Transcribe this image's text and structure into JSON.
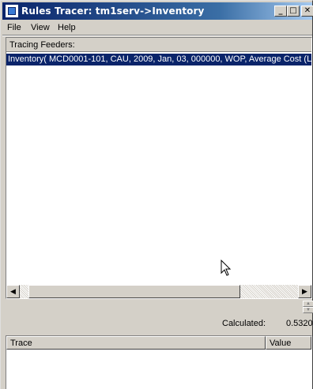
{
  "window": {
    "title": "Rules Tracer: tm1serv->Inventory",
    "controls": {
      "minimize": "_",
      "maximize": "□",
      "close": "✕"
    }
  },
  "menu": {
    "file": "File",
    "view": "View",
    "help": "Help"
  },
  "feeders": {
    "header": "Tracing Feeders:",
    "rows": [
      "Inventory( MCD0001-101, CAU, 2009, Jan, 03, 000000, WOP, Average Cost (L"
    ]
  },
  "calculated": {
    "label": "Calculated:",
    "value": "0.5320"
  },
  "trace_table": {
    "columns": [
      "Trace",
      "Value"
    ]
  },
  "icons": {
    "app": "app-icon",
    "cursor": "mouse-pointer-icon"
  },
  "colors": {
    "titlebar_start": "#0a246a",
    "titlebar_end": "#a6caf0",
    "selection": "#0a246a",
    "face": "#d4d0c8"
  }
}
